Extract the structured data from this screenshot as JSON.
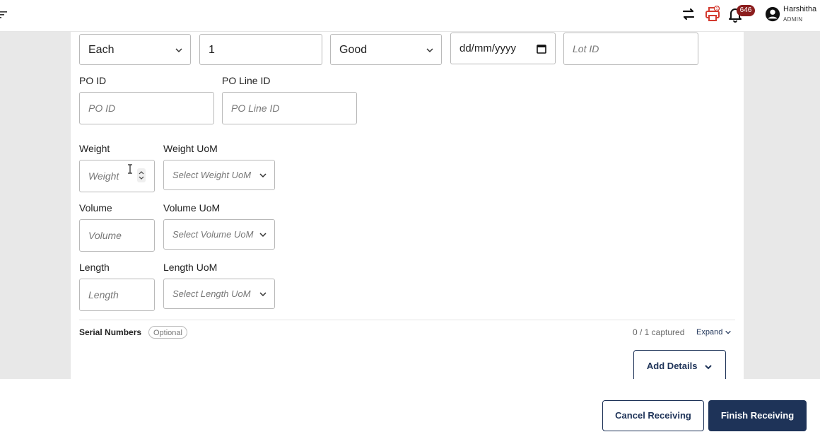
{
  "header": {
    "notification_count": "646",
    "user_name": "Harshitha",
    "user_role": "ADMIN",
    "icons": [
      "menu-icon",
      "swap-icon",
      "printer-icon",
      "bell-icon",
      "user-icon"
    ]
  },
  "row1": {
    "uom_value": "Each",
    "quantity_value": "1",
    "condition_value": "Good",
    "date_placeholder": "dd/mm/yyyy",
    "lot_placeholder": "Lot ID"
  },
  "po": {
    "po_id_label": "PO ID",
    "po_id_placeholder": "PO ID",
    "po_line_label": "PO Line ID",
    "po_line_placeholder": "PO Line ID"
  },
  "dimensions": {
    "weight_label": "Weight",
    "weight_placeholder": "Weight",
    "weight_uom_label": "Weight UoM",
    "weight_uom_placeholder": "Select Weight UoM",
    "volume_label": "Volume",
    "volume_placeholder": "Volume",
    "volume_uom_label": "Volume UoM",
    "volume_uom_placeholder": "Select Volume UoM",
    "length_label": "Length",
    "length_placeholder": "Length",
    "length_uom_label": "Length UoM",
    "length_uom_placeholder": "Select Length UoM"
  },
  "serial": {
    "label": "Serial Numbers",
    "optional": "Optional",
    "captured": "0 / 1 captured",
    "expand": "Expand"
  },
  "actions": {
    "add_details": "Add Details",
    "cancel": "Cancel Receiving",
    "finish": "Finish Receiving"
  },
  "colors": {
    "primary": "#1e3358",
    "badge": "#8b1d1d",
    "printer": "#d33a2f",
    "background": "#e8e8e8"
  }
}
